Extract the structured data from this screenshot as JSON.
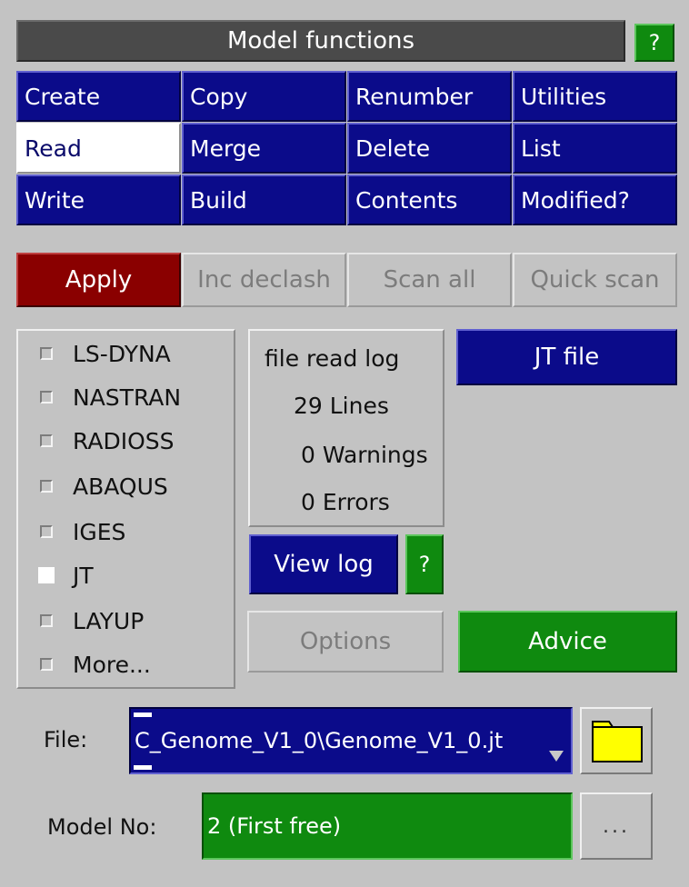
{
  "header": {
    "title": "Model functions",
    "help_label": "?"
  },
  "functions": {
    "rows": [
      [
        "Create",
        "Copy",
        "Renumber",
        "Utilities"
      ],
      [
        "Read",
        "Merge",
        "Delete",
        "List"
      ],
      [
        "Write",
        "Build",
        "Contents",
        "Modified?"
      ]
    ],
    "selected": "Read"
  },
  "actions": {
    "apply": "Apply",
    "inc_declash": "Inc declash",
    "scan_all": "Scan all",
    "quick_scan": "Quick scan"
  },
  "formats": [
    {
      "label": "LS-DYNA",
      "checked": false
    },
    {
      "label": "NASTRAN",
      "checked": false
    },
    {
      "label": "RADIOSS",
      "checked": false
    },
    {
      "label": "ABAQUS",
      "checked": false
    },
    {
      "label": "IGES",
      "checked": false
    },
    {
      "label": "JT",
      "checked": true
    },
    {
      "label": "LAYUP",
      "checked": false
    },
    {
      "label": "More...",
      "checked": false
    }
  ],
  "log": {
    "title": "file read log",
    "lines": "29 Lines",
    "warnings": "0 Warnings",
    "errors": "0 Errors",
    "view_log": "View log",
    "help": "?"
  },
  "jt_file_button": "JT file",
  "options_button": "Options",
  "advice_button": "Advice",
  "file": {
    "label": "File:",
    "value": "C_Genome_V1_0\\Genome_V1_0.jt"
  },
  "model": {
    "label": "Model No:",
    "value": "2 (First free)",
    "more_button": "..."
  },
  "colors": {
    "background": "#c3c3c3",
    "blue": "#0b0b8a",
    "green": "#0f8a0f",
    "red": "#8a0000",
    "folder": "#ffff00"
  }
}
